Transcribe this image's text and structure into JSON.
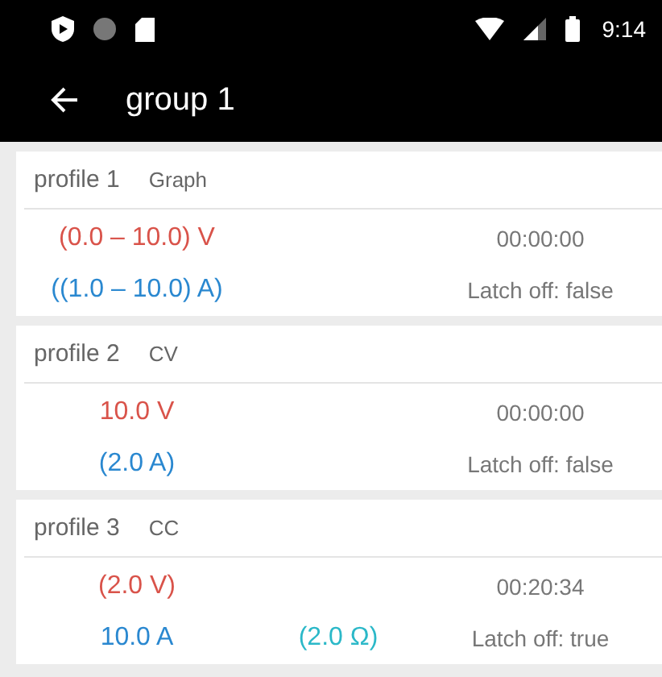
{
  "status_bar": {
    "time": "9:14"
  },
  "toolbar": {
    "title": "group 1"
  },
  "profiles": [
    {
      "name": "profile 1",
      "mode": "Graph",
      "voltage": "(0.0 – 10.0) V",
      "current": "((1.0 – 10.0) A)",
      "time": "00:00:00",
      "latch": "Latch off: false"
    },
    {
      "name": "profile 2",
      "mode": "CV",
      "voltage": "10.0 V",
      "current": "(2.0 A)",
      "time": "00:00:00",
      "latch": "Latch off: false"
    },
    {
      "name": "profile 3",
      "mode": "CC",
      "voltage": "(2.0 V)",
      "current": "10.0 A",
      "resistance": "(2.0 Ω)",
      "time": "00:20:34",
      "latch": "Latch off: true"
    }
  ]
}
